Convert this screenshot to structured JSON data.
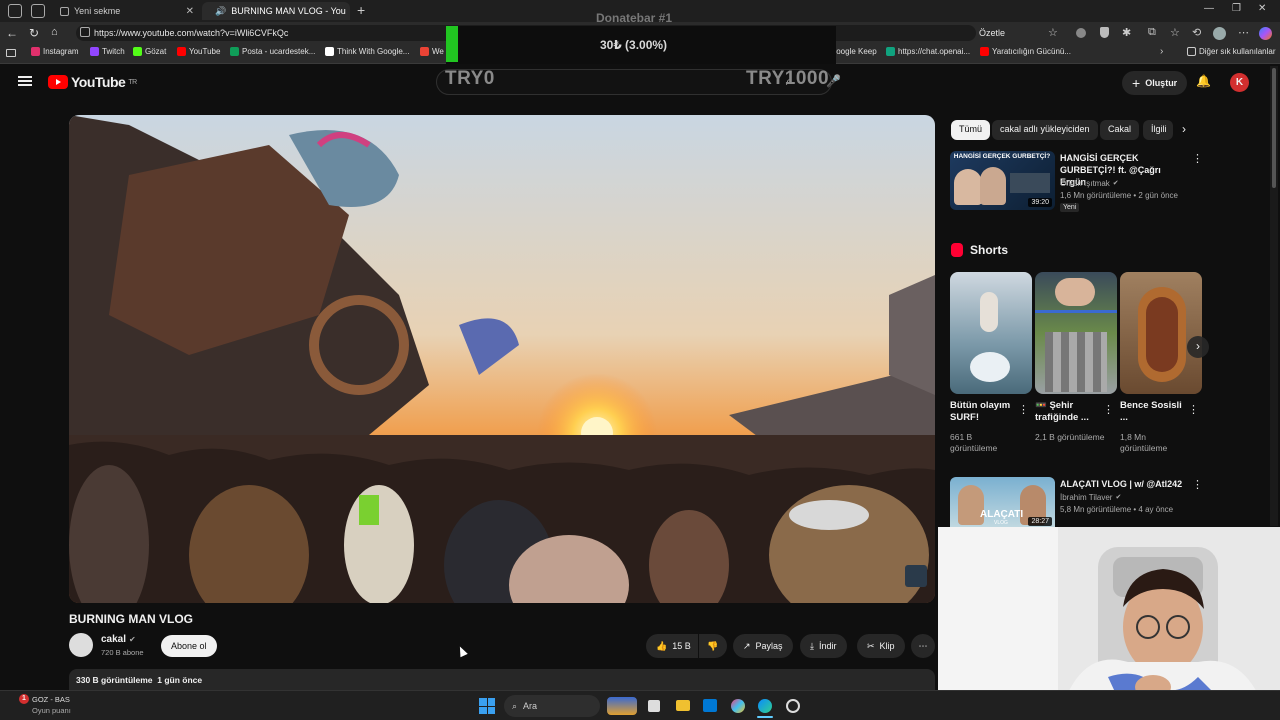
{
  "browser": {
    "tabs": [
      {
        "label": "Yeni sekme"
      },
      {
        "label": "BURNING MAN VLOG - You"
      }
    ],
    "url": "https://www.youtube.com/watch?v=iWli6CVFkQc",
    "summarize_label": "Özetle",
    "bookmarks": [
      {
        "label": "Instagram",
        "color": "#e1306c"
      },
      {
        "label": "Twitch",
        "color": "#9146ff"
      },
      {
        "label": "Gözat",
        "color": "#53fc18"
      },
      {
        "label": "YouTube",
        "color": "#ff0000"
      },
      {
        "label": "Posta - ucardestek...",
        "color": "#0f9d58"
      },
      {
        "label": "Think With Google...",
        "color": "#ffffff"
      },
      {
        "label": "We",
        "color": "#ea4335"
      },
      {
        "label": "Google Keep",
        "color": "#fbbc04"
      },
      {
        "label": "https://chat.openai...",
        "color": "#10a37f"
      },
      {
        "label": "Yaratıcılığın Gücünü...",
        "color": "#ff0000"
      }
    ],
    "other_bookmarks": "Diğer sık kullanılanlar"
  },
  "overlay": {
    "donatebar_title": "Donatebar #1",
    "amount": "30₺ (3.00%)",
    "min_label": "TRY0",
    "max_label": "TRY1000",
    "progress": 0.03
  },
  "youtube": {
    "logo_text": "YouTube",
    "logo_region": "TR",
    "create_label": "Oluştur",
    "video_title": "BURNING MAN VLOG",
    "channel_name": "cakal",
    "subscribers": "720 B abone",
    "subscribe_label": "Abone ol",
    "likes": "15 B",
    "share_label": "Paylaş",
    "download_label": "İndir",
    "clip_label": "Klip",
    "views_line": "330 B görüntüleme  1 gün önce",
    "chips": [
      "Tümü",
      "cakal adlı yükleyiciden",
      "Cakal",
      "İlgili"
    ],
    "recommended": [
      {
        "title": "HANGİSİ GERÇEK GURBETÇİ?! ft. @Çağrı Ergün",
        "thumb_text": "HANGİSİ GERÇEK GURBETÇİ?",
        "channel": "Orkun Işıtmak",
        "stats": "1,6 Mn görüntüleme • 2 gün önce",
        "badge": "Yeni",
        "duration": "39:20"
      },
      {
        "title": "ALAÇATI VLOG | w/ @Atl242",
        "thumb_text": "ALAÇATI",
        "thumb_sub": "VLOG",
        "channel": "İbrahim Tilaver",
        "stats": "5,8 Mn görüntüleme • 4 ay önce",
        "duration": "28:27"
      }
    ],
    "shorts_heading": "Shorts",
    "shorts": [
      {
        "title": "Bütün olayım SURF!",
        "views": "661 B görüntüleme"
      },
      {
        "title": "🚥 Şehir trafiğinde ...",
        "views": "2,1 B görüntüleme"
      },
      {
        "title": "Bence Sosisli ...",
        "views": "1,8 Mn görüntüleme"
      }
    ]
  },
  "taskbar": {
    "notification_title": "GOZ - BAS",
    "notification_sub": "Oyun puanı",
    "notification_count": "1",
    "search_placeholder": "Ara"
  }
}
